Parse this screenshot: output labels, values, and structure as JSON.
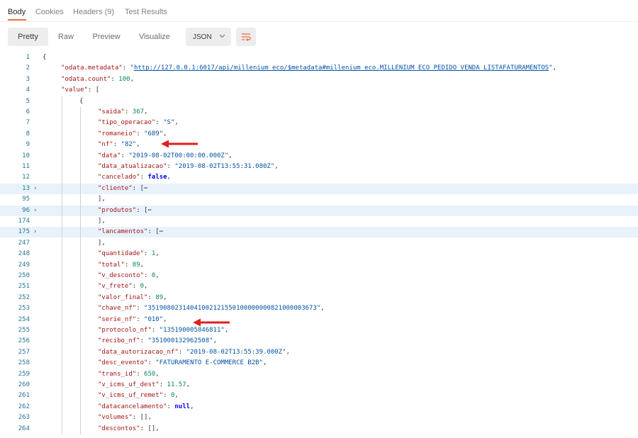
{
  "response_tabs": [
    {
      "label": "Body"
    },
    {
      "label": "Cookies"
    },
    {
      "label": "Headers (9)"
    },
    {
      "label": "Test Results"
    }
  ],
  "toolbar": {
    "pretty_label": "Pretty",
    "raw_label": "Raw",
    "preview_label": "Preview",
    "visualize_label": "Visualize",
    "format_selected": "JSON"
  },
  "lines": [
    {
      "n": "1",
      "t": "{"
    },
    {
      "n": "2",
      "t": "\"odata.metadata\": \"http://127.0.0.1:6017/api/millenium_eco/$metadata#millenium_eco.MILLENIUM_ECO_PEDIDO_VENDA_LISTAFATURAMENTOS\","
    },
    {
      "n": "3",
      "t": "\"odata.count\": 100,"
    },
    {
      "n": "4",
      "t": "\"value\": ["
    },
    {
      "n": "5",
      "t": "{"
    },
    {
      "n": "6",
      "t": "\"saida\": 367,"
    },
    {
      "n": "7",
      "t": "\"tipo_operacao\": \"S\","
    },
    {
      "n": "8",
      "t": "\"romaneio\": \"689\","
    },
    {
      "n": "9",
      "t": "\"nf\": \"82\","
    },
    {
      "n": "10",
      "t": "\"data\": \"2019-08-02T00:00:00.000Z\","
    },
    {
      "n": "11",
      "t": "\"data_atualizacao\": \"2019-08-02T13:55:31.080Z\","
    },
    {
      "n": "12",
      "t": "\"cancelado\": false,"
    },
    {
      "n": "13",
      "t": "\"cliente\": [⋯"
    },
    {
      "n": "95",
      "t": "],"
    },
    {
      "n": "96",
      "t": "\"produtos\": [⋯"
    },
    {
      "n": "174",
      "t": "],"
    },
    {
      "n": "175",
      "t": "\"lancamentos\": [⋯"
    },
    {
      "n": "247",
      "t": "],"
    },
    {
      "n": "248",
      "t": "\"quantidade\": 1,"
    },
    {
      "n": "249",
      "t": "\"total\": 89,"
    },
    {
      "n": "250",
      "t": "\"v_desconto\": 0,"
    },
    {
      "n": "251",
      "t": "\"v_frete\": 0,"
    },
    {
      "n": "252",
      "t": "\"valor_final\": 89,"
    },
    {
      "n": "253",
      "t": "\"chave_nf\": \"35190802314041002121550100000000821000003673\","
    },
    {
      "n": "254",
      "t": "\"serie_nf\": \"010\","
    },
    {
      "n": "255",
      "t": "\"protocolo_nf\": \"135190005846811\","
    },
    {
      "n": "256",
      "t": "\"recibo_nf\": \"351000132962508\","
    },
    {
      "n": "257",
      "t": "\"data_autorizacao_nf\": \"2019-08-02T13:55:39.000Z\","
    },
    {
      "n": "258",
      "t": "\"desc_evento\": \"FATURAMENTO E-COMMERCE B2B\","
    },
    {
      "n": "259",
      "t": "\"trans_id\": 650,"
    },
    {
      "n": "260",
      "t": "\"v_icms_uf_dest\": 11.57,"
    },
    {
      "n": "261",
      "t": "\"v_icms_uf_remet\": 0,"
    },
    {
      "n": "262",
      "t": "\"datacancelamento\": null,"
    },
    {
      "n": "263",
      "t": "\"volumes\": [],"
    },
    {
      "n": "264",
      "t": "\"descontos\": [],"
    }
  ],
  "colors": {
    "accent": "#f26b3a",
    "annotation_arrow": "#e0201b",
    "key": "#a31515",
    "string": "#0451a5",
    "number": "#098658",
    "line_number": "#237893",
    "highlight": "#e8f2fb"
  }
}
